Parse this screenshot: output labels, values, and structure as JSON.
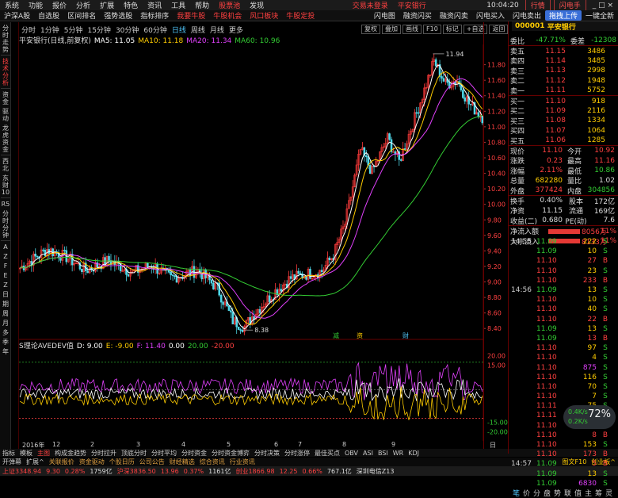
{
  "menu": [
    "系统",
    "功能",
    "报价",
    "分析",
    "扩展",
    "特色",
    "资讯",
    "工具",
    "帮助",
    "股票池",
    "发现"
  ],
  "menu_hl": [
    "股票池"
  ],
  "menu_right": [
    "交易未登录",
    "平安银行"
  ],
  "clock": "10:04:20",
  "menu_btn": [
    "行情",
    "闪电手"
  ],
  "top_nav": [
    "沪深A股",
    "自选股",
    "区间排名",
    "强势选股",
    "指标排序",
    "我要牛股",
    "牛股机会",
    "风口板块",
    "牛股定投"
  ],
  "top_nav_hl": [
    "我要牛股",
    "牛股机会",
    "风口板块",
    "牛股定投"
  ],
  "top_nav_right": [
    "闪电图",
    "融资闪买",
    "融资闪卖",
    "闪电买入",
    "闪电卖出",
    "拖拽上传",
    "一键全新"
  ],
  "left_nav": [
    "分时走势",
    "技术分析",
    "资金",
    "驱动",
    "龙虎资金",
    "西北",
    "东财10",
    "R5",
    "分时分钟",
    "A",
    "Z",
    "F",
    "E",
    "Z",
    "日",
    "期",
    "周",
    "月",
    "多",
    "季",
    "年"
  ],
  "timeframes": [
    "分时",
    "1分钟",
    "5分钟",
    "15分钟",
    "30分钟",
    "60分钟",
    "日线",
    "周线",
    "月线",
    "更多"
  ],
  "timeframe_active": "日线",
  "chart_btns": [
    "复权",
    "叠加",
    "画线",
    "F10",
    "标记",
    "+自选",
    "返回"
  ],
  "ma_title": "平安银行(日线,前复权)",
  "ma": [
    {
      "label": "MA5: 11.05",
      "color": "#ffffff"
    },
    {
      "label": "MA10: 11.18",
      "color": "#ffcc00"
    },
    {
      "label": "MA20: 11.34",
      "color": "#e040fb"
    },
    {
      "label": "MA60: 10.96",
      "color": "#33cc33"
    }
  ],
  "price_axis": [
    "11.80",
    "11.60",
    "11.40",
    "11.20",
    "11.00",
    "10.80",
    "10.60",
    "10.40",
    "10.20",
    "10.00",
    "9.80",
    "9.60",
    "9.40",
    "9.20",
    "9.00",
    "8.80",
    "8.60",
    "8.40"
  ],
  "annot_high": "11.94",
  "annot_low": "8.38",
  "markers": [
    "减",
    "资",
    "财"
  ],
  "ind_label": "S理论AVEDEV值",
  "ind_vals": [
    {
      "t": "D: 9.00",
      "c": "#ffffff"
    },
    {
      "t": "E: -9.00",
      "c": "#ffcc00"
    },
    {
      "t": "F: 11.40",
      "c": "#e040fb"
    },
    {
      "t": "0.00",
      "c": "#ffffff"
    },
    {
      "t": "20.00",
      "c": "#33cc33"
    },
    {
      "t": "-20.00",
      "c": "#ff4040"
    }
  ],
  "ind_axis": [
    "20.00",
    "15.00",
    "-15.00",
    "-20.00"
  ],
  "dates": [
    "2016年",
    "12",
    "2",
    "3",
    "4",
    "5",
    "6",
    "7",
    "8",
    "9"
  ],
  "period_label": "日线",
  "tabs": [
    "指标",
    "模板",
    "主图",
    "构成金趋势",
    "分时拉升",
    "顶底分时",
    "分时平均",
    "分时资金",
    "分时资金博弈",
    "分时决策",
    "分时涨停",
    "最佳买点",
    "OBV",
    "ASI",
    "BSI",
    "WR",
    "KDJ"
  ],
  "tab_active": "主图",
  "tabs2": [
    "开弹幕",
    "扩展^",
    "关联报价",
    "资金驱动",
    "个股日历",
    "公司公告",
    "财经精选",
    "综合资讯",
    "行业资讯"
  ],
  "tabs2_right": [
    "图文F10",
    "创业板^"
  ],
  "status": [
    {
      "t": "上证3348.94",
      "c": "r"
    },
    {
      "t": "9.30",
      "c": "r"
    },
    {
      "t": "0.28%",
      "c": "r"
    },
    {
      "t": "1759亿",
      "c": "w"
    },
    {
      "t": "沪深3836.50",
      "c": "r"
    },
    {
      "t": "13.96",
      "c": "r"
    },
    {
      "t": "0.37%",
      "c": "r"
    },
    {
      "t": "1161亿",
      "c": "w"
    },
    {
      "t": "创业1866.98",
      "c": "r"
    },
    {
      "t": "12.25",
      "c": "r"
    },
    {
      "t": "0.66%",
      "c": "r"
    },
    {
      "t": "767.1亿",
      "c": "w"
    },
    {
      "t": "深圳电信Z13",
      "c": "w"
    }
  ],
  "stock": {
    "code": "000001",
    "name": "平安银行"
  },
  "weibi": {
    "l1": "委比",
    "v1": "-47.71%",
    "l2": "委差",
    "v2": "-12308"
  },
  "sells": [
    [
      "卖五",
      "11.15",
      "3486"
    ],
    [
      "卖四",
      "11.14",
      "3485"
    ],
    [
      "卖三",
      "11.13",
      "2998"
    ],
    [
      "卖二",
      "11.12",
      "1948"
    ],
    [
      "卖一",
      "11.11",
      "5752"
    ]
  ],
  "buys": [
    [
      "买一",
      "11.10",
      "918"
    ],
    [
      "买二",
      "11.09",
      "2116"
    ],
    [
      "买三",
      "11.08",
      "1334"
    ],
    [
      "买四",
      "11.07",
      "1064"
    ],
    [
      "买五",
      "11.06",
      "1285"
    ]
  ],
  "stats": [
    [
      "现价",
      "11.10",
      "今开",
      "10.92"
    ],
    [
      "涨跌",
      "0.23",
      "最高",
      "11.16"
    ],
    [
      "涨幅",
      "2.11%",
      "最低",
      "10.86"
    ],
    [
      "总量",
      "682280",
      "量比",
      "1.02"
    ],
    [
      "外盘",
      "377424",
      "内盘",
      "304856"
    ]
  ],
  "stats2": [
    [
      "换手",
      "0.40%",
      "股本",
      "172亿"
    ],
    [
      "净资",
      "11.15",
      "流通",
      "169亿"
    ],
    [
      "收益(二)",
      "0.680",
      "PE(动)",
      "7.6"
    ]
  ],
  "flow": [
    {
      "l": "净流入额",
      "v": "8056万",
      "p": "11%"
    },
    {
      "l": "大宗流入",
      "v": "8133万",
      "p": "11%"
    }
  ],
  "ticks": [
    [
      "14:55",
      "11.09",
      "222",
      "S"
    ],
    [
      "",
      "11.09",
      "10",
      "S"
    ],
    [
      "",
      "11.10",
      "27",
      "B"
    ],
    [
      "",
      "11.10",
      "23",
      "S"
    ],
    [
      "",
      "11.10",
      "233",
      "B"
    ],
    [
      "14:56",
      "11.09",
      "13",
      "S"
    ],
    [
      "",
      "11.10",
      "10",
      "S"
    ],
    [
      "",
      "11.10",
      "40",
      "S"
    ],
    [
      "",
      "11.10",
      "22",
      "B"
    ],
    [
      "",
      "11.09",
      "13",
      "S"
    ],
    [
      "",
      "11.09",
      "13",
      "B"
    ],
    [
      "",
      "11.10",
      "97",
      "S"
    ],
    [
      "",
      "11.10",
      "4",
      "S"
    ],
    [
      "",
      "11.10",
      "875",
      "S"
    ],
    [
      "",
      "11.10",
      "116",
      "S"
    ],
    [
      "",
      "11.10",
      "70",
      "S"
    ],
    [
      "",
      "11.10",
      "7",
      "S"
    ],
    [
      "",
      "11.11",
      "75",
      "S"
    ],
    [
      "",
      "11.11",
      "8",
      "S"
    ],
    [
      "",
      "11.10",
      "5",
      "S"
    ],
    [
      "",
      "11.10",
      "8",
      "B"
    ],
    [
      "",
      "11.10",
      "153",
      "S"
    ],
    [
      "",
      "11.10",
      "173",
      "B"
    ],
    [
      "14:57",
      "11.09",
      "5",
      "B"
    ],
    [
      "",
      "11.09",
      "13",
      "S"
    ],
    [
      "",
      "11.09",
      "6830",
      "S"
    ]
  ],
  "tick_bottom": [
    "笔",
    "价",
    "分",
    "盘",
    "势",
    "联",
    "值",
    "主",
    "筹",
    "灵"
  ],
  "circle": {
    "up": "0.4K/s",
    "down": "0.2K/s",
    "pct": "72%"
  }
}
